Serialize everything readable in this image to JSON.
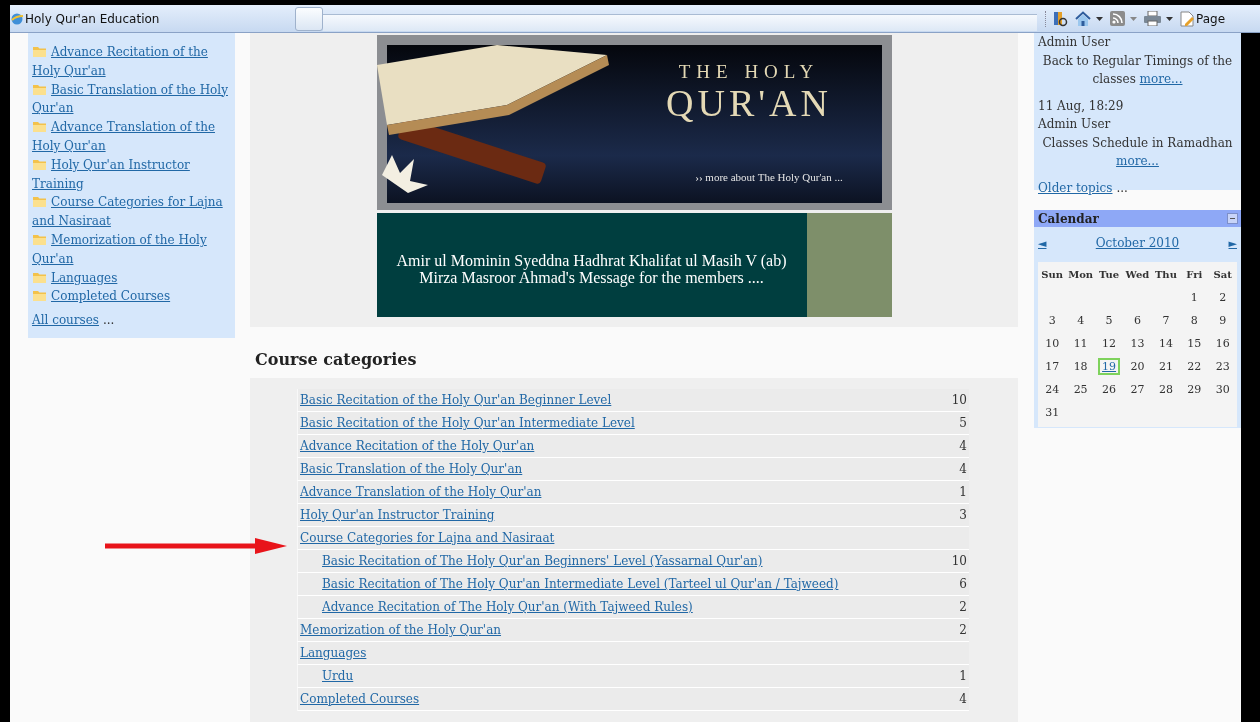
{
  "window": {
    "title": "Holy Qur'an Education",
    "page_menu": "Page"
  },
  "category_block": {
    "items": [
      {
        "label": "Advance Recitation of the Holy Qur'an"
      },
      {
        "label": "Basic Translation of the Holy Qur'an"
      },
      {
        "label": "Advance Translation of the Holy Qur'an"
      },
      {
        "label": "Holy Qur'an Instructor Training"
      },
      {
        "label": "Course Categories for Lajna and Nasiraat"
      },
      {
        "label": "Memorization of the Holy Qur'an"
      },
      {
        "label": "Languages"
      },
      {
        "label": "Completed Courses"
      }
    ],
    "all_link": "All courses",
    "all_suffix": "..."
  },
  "banner": {
    "heading_small": "THE HOLY",
    "heading_large": "QUR'AN",
    "more_link": "›› more about The Holy Qur'an ...",
    "message_lines": [
      "Amir ul Mominin Syeddna Hadhrat Khalifat ul Masih V (ab)",
      "Mirza Masroor Ahmad's Message for the members ...."
    ]
  },
  "course_categories": {
    "title": "Course categories",
    "rows": [
      {
        "name": "Basic Recitation of the Holy Qur'an Beginner Level",
        "count": "10"
      },
      {
        "name": "Basic Recitation of the Holy Qur'an Intermediate Level",
        "count": "5"
      },
      {
        "name": "Advance Recitation of the Holy Qur'an",
        "count": "4"
      },
      {
        "name": "Basic Translation of the Holy Qur'an",
        "count": "4"
      },
      {
        "name": "Advance Translation of the Holy Qur'an",
        "count": "1"
      },
      {
        "name": "Holy Qur'an Instructor Training",
        "count": "3"
      },
      {
        "name": "Course Categories for Lajna and Nasiraat",
        "children": [
          {
            "name": "Basic Recitation of The Holy Qur'an Beginners' Level (Yassarnal Qur'an)",
            "count": "10"
          },
          {
            "name": "Basic Recitation of The Holy Qur'an Intermediate Level (Tarteel ul Qur'an / Tajweed)",
            "count": "6"
          },
          {
            "name": "Advance Recitation of The Holy Qur'an (With Tajweed Rules)",
            "count": "2"
          }
        ]
      },
      {
        "name": "Memorization of the Holy Qur'an",
        "count": "2"
      },
      {
        "name": "Languages",
        "children": [
          {
            "name": "Urdu",
            "count": "1"
          }
        ]
      },
      {
        "name": "Completed Courses",
        "count": "4"
      }
    ]
  },
  "news": {
    "items": [
      {
        "author": "Admin User",
        "subject": "Back to Regular Timings of the classes",
        "more": "more..."
      },
      {
        "date": "11 Aug, 18:29",
        "author": "Admin User",
        "subject": "Classes Schedule in Ramadhan",
        "more": "more..."
      }
    ],
    "older_link": "Older topics",
    "older_suffix": "..."
  },
  "calendar": {
    "title": "Calendar",
    "prev": "◄",
    "month": "October 2010",
    "next": "►",
    "weekdays": [
      "Sun",
      "Mon",
      "Tue",
      "Wed",
      "Thu",
      "Fri",
      "Sat"
    ],
    "weeks": [
      [
        {
          "day": "1",
          "today": false
        },
        {
          "day": "2",
          "today": false
        }
      ],
      [
        {
          "day": "3",
          "today": false
        },
        {
          "day": "4",
          "today": false
        },
        {
          "day": "5",
          "today": false
        },
        {
          "day": "6",
          "today": false
        },
        {
          "day": "7",
          "today": false
        },
        {
          "day": "8",
          "today": false
        },
        {
          "day": "9",
          "today": false
        }
      ],
      [
        {
          "day": "10",
          "today": false
        },
        {
          "day": "11",
          "today": false
        },
        {
          "day": "12",
          "today": false
        },
        {
          "day": "13",
          "today": false
        },
        {
          "day": "14",
          "today": false
        },
        {
          "day": "15",
          "today": false
        },
        {
          "day": "16",
          "today": false
        }
      ],
      [
        {
          "day": "17",
          "today": false
        },
        {
          "day": "18",
          "today": false
        },
        {
          "day": "19",
          "today": true
        },
        {
          "day": "20",
          "today": false
        },
        {
          "day": "21",
          "today": false
        },
        {
          "day": "22",
          "today": false
        },
        {
          "day": "23",
          "today": false
        }
      ],
      [
        {
          "day": "24",
          "today": false
        },
        {
          "day": "25",
          "today": false
        },
        {
          "day": "26",
          "today": false
        },
        {
          "day": "27",
          "today": false
        },
        {
          "day": "28",
          "today": false
        },
        {
          "day": "29",
          "today": false
        },
        {
          "day": "30",
          "today": false
        }
      ],
      [
        {
          "day": "31",
          "today": false
        }
      ]
    ]
  }
}
